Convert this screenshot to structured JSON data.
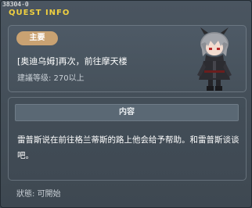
{
  "quest_id": "38304-0",
  "window_title": "QUEST INFO",
  "badge": "主要",
  "quest_name": "[奥迪乌姆]再次，前往摩天楼",
  "recommended_level": "建議等级: 270以上",
  "content_title": "内容",
  "description": "雷普斯说在前往格兰蒂斯的路上他会给予帮助。和雷普斯谈谈吧。",
  "status": "狀態:  可開始",
  "icons": {
    "portrait": "character-portrait-icon"
  },
  "colors": {
    "title": "#f0d040",
    "badge": "#c9a272",
    "window_bg": "#3e4851"
  }
}
